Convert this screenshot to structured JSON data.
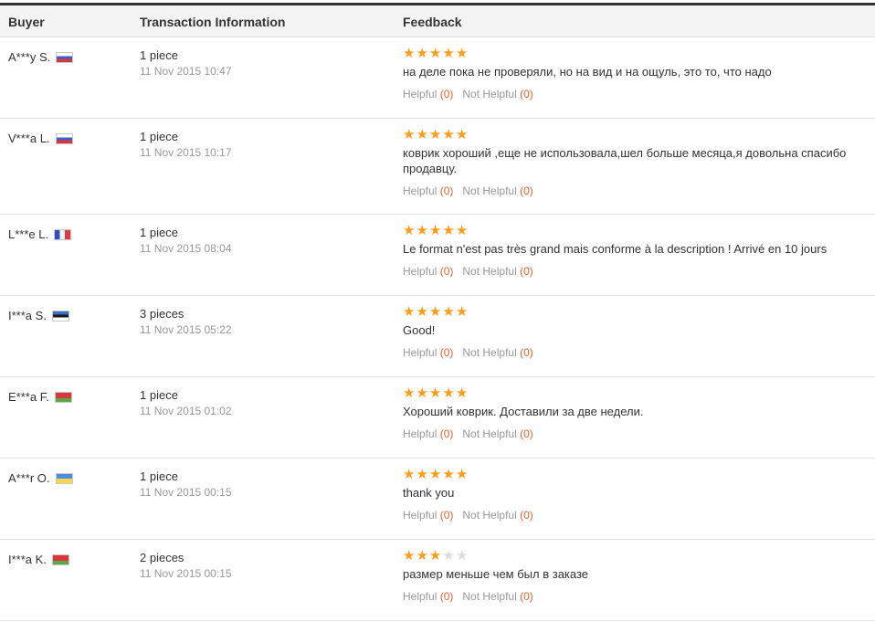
{
  "header": {
    "buyer": "Buyer",
    "transaction": "Transaction Information",
    "feedback": "Feedback"
  },
  "labels": {
    "helpful": "Helpful",
    "not_helpful": "Not Helpful"
  },
  "colors": {
    "star_filled": "#ff9d1a",
    "star_empty": "#dddddd",
    "vote_count": "#e4632e",
    "header_bg": "#f3f3f3"
  },
  "reviews": [
    {
      "buyer": "A***y S.",
      "flag": "russia-flag",
      "quantity": "1 piece",
      "date": "11 Nov 2015 10:47",
      "rating": 5,
      "comment": "на деле пока не проверяли, но на вид и на ощуль, это то, что надо",
      "helpful": "(0)",
      "not_helpful": "(0)"
    },
    {
      "buyer": "V***a L.",
      "flag": "russia-flag",
      "quantity": "1 piece",
      "date": "11 Nov 2015 10:17",
      "rating": 5,
      "comment": "коврик хороший ,еще не использовала,шел больше месяца,я довольна спасибо продавцу.",
      "helpful": "(0)",
      "not_helpful": "(0)"
    },
    {
      "buyer": "L***e L.",
      "flag": "france-flag",
      "quantity": "1 piece",
      "date": "11 Nov 2015 08:04",
      "rating": 5,
      "comment": "Le format n'est pas très grand mais conforme à la description ! Arrivé en 10 jours",
      "helpful": "(0)",
      "not_helpful": "(0)"
    },
    {
      "buyer": "I***a S.",
      "flag": "estonia-flag",
      "quantity": "3 pieces",
      "date": "11 Nov 2015 05:22",
      "rating": 5,
      "comment": "Good!",
      "helpful": "(0)",
      "not_helpful": "(0)"
    },
    {
      "buyer": "E***a F.",
      "flag": "belarus-flag",
      "quantity": "1 piece",
      "date": "11 Nov 2015 01:02",
      "rating": 5,
      "comment": "Хороший коврик. Доставили за две недели.",
      "helpful": "(0)",
      "not_helpful": "(0)"
    },
    {
      "buyer": "A***r O.",
      "flag": "ukraine-flag",
      "quantity": "1 piece",
      "date": "11 Nov 2015 00:15",
      "rating": 5,
      "comment": "thank you",
      "helpful": "(0)",
      "not_helpful": "(0)"
    },
    {
      "buyer": "I***a K.",
      "flag": "belarus-flag",
      "quantity": "2 pieces",
      "date": "11 Nov 2015 00:15",
      "rating": 3,
      "comment": "размер меньше чем был в заказе",
      "helpful": "(0)",
      "not_helpful": "(0)"
    }
  ]
}
